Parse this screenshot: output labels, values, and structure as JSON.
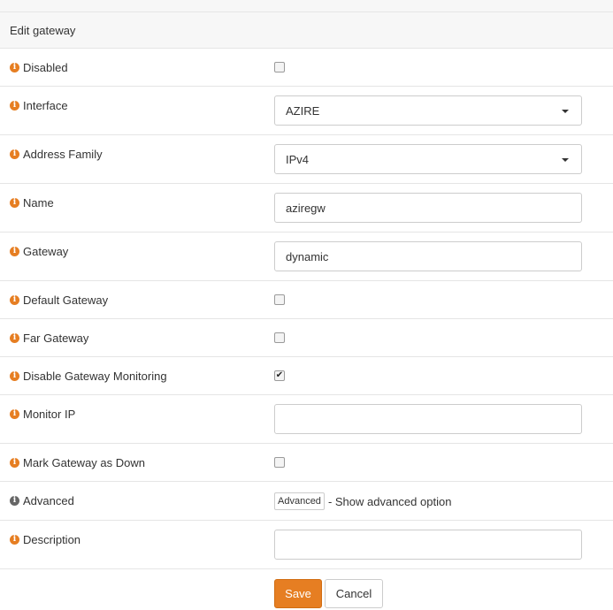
{
  "header": {
    "title": "Edit gateway"
  },
  "fields": {
    "disabled": {
      "label": "Disabled",
      "checked": false
    },
    "interface": {
      "label": "Interface",
      "value": "AZIRE"
    },
    "address_family": {
      "label": "Address Family",
      "value": "IPv4"
    },
    "name": {
      "label": "Name",
      "value": "aziregw"
    },
    "gateway": {
      "label": "Gateway",
      "value": "dynamic"
    },
    "default_gateway": {
      "label": "Default Gateway",
      "checked": false
    },
    "far_gateway": {
      "label": "Far Gateway",
      "checked": false
    },
    "disable_monitoring": {
      "label": "Disable Gateway Monitoring",
      "checked": true,
      "mark": "✔"
    },
    "monitor_ip": {
      "label": "Monitor IP",
      "value": ""
    },
    "mark_down": {
      "label": "Mark Gateway as Down",
      "checked": false
    },
    "advanced": {
      "label": "Advanced",
      "button_label": "Advanced",
      "hint": "- Show advanced option"
    },
    "description": {
      "label": "Description",
      "value": ""
    }
  },
  "info_glyph": "i",
  "actions": {
    "save_label": "Save",
    "cancel_label": "Cancel"
  },
  "colors": {
    "accent": "#e67e22",
    "info_grey": "#666666"
  }
}
